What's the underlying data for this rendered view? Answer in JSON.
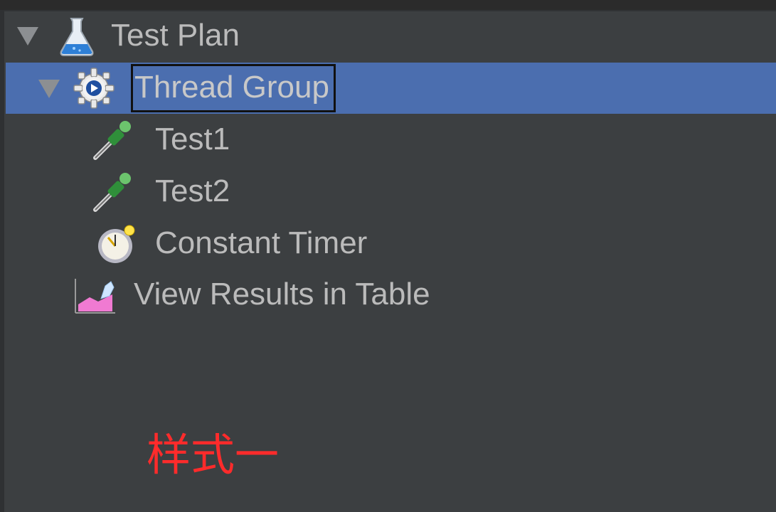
{
  "tree": {
    "items": [
      {
        "label": "Test Plan",
        "icon": "flask-icon",
        "expanded": true
      },
      {
        "label": "Thread Group",
        "icon": "gear-icon",
        "expanded": true,
        "selected": true
      },
      {
        "label": "Test1",
        "icon": "dropper-icon"
      },
      {
        "label": "Test2",
        "icon": "dropper-icon"
      },
      {
        "label": "Constant Timer",
        "icon": "stopwatch-icon"
      },
      {
        "label": "View Results in Table",
        "icon": "chart-icon"
      }
    ]
  },
  "caption": "样式一",
  "colors": {
    "background": "#3c3f41",
    "selection": "#4b6eaf",
    "text": "#bbbbbb",
    "caption": "#ff2b2b"
  }
}
